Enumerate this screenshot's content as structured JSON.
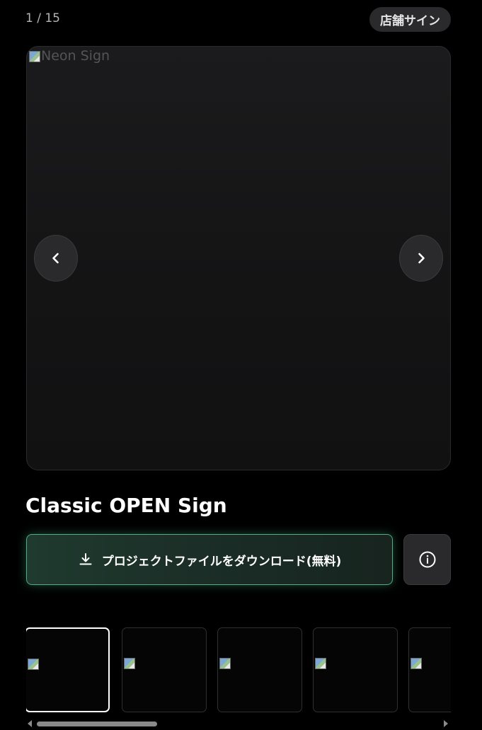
{
  "header": {
    "counter": "1 / 15",
    "category": "店舗サイン"
  },
  "viewer": {
    "image_alt": "Neon Sign"
  },
  "item": {
    "title": "Classic OPEN Sign"
  },
  "actions": {
    "download_label": "プロジェクトファイルをダウンロード(無料)"
  },
  "thumbnails": [
    {
      "active": true
    },
    {
      "active": false
    },
    {
      "active": false
    },
    {
      "active": false
    },
    {
      "active": false
    }
  ],
  "colors": {
    "background": "#000000",
    "accent_green": "#4fae86",
    "button_dark": "#2a2a2c"
  }
}
